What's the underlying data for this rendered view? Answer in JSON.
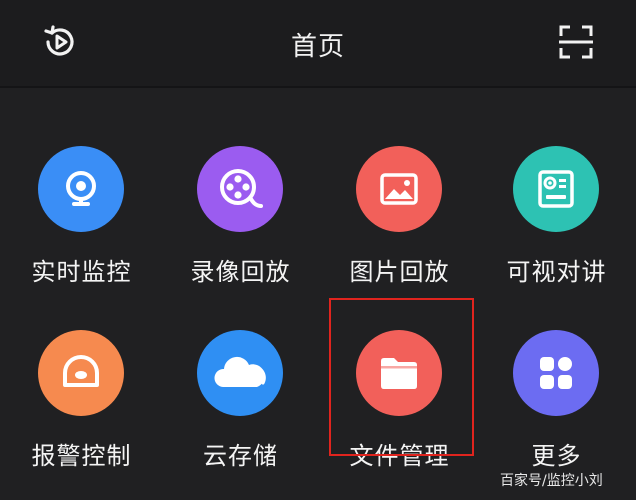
{
  "header": {
    "title": "首页",
    "left_icon": "playback-history-icon",
    "right_icon": "scan-icon"
  },
  "features": [
    {
      "label": "实时监控",
      "icon": "camera-icon",
      "color": "#3a8ef6"
    },
    {
      "label": "录像回放",
      "icon": "film-reel-icon",
      "color": "#9b5cf0"
    },
    {
      "label": "图片回放",
      "icon": "image-icon",
      "color": "#f2605a"
    },
    {
      "label": "可视对讲",
      "icon": "intercom-icon",
      "color": "#2dc2b3"
    },
    {
      "label": "报警控制",
      "icon": "alarm-icon",
      "color": "#f68a4f"
    },
    {
      "label": "云存储",
      "icon": "cloud-icon",
      "color": "#2f8ff3"
    },
    {
      "label": "文件管理",
      "icon": "folder-icon",
      "color": "#f2605a"
    },
    {
      "label": "更多",
      "icon": "more-grid-icon",
      "color": "#6c6cf2"
    }
  ],
  "selected_feature": "文件管理",
  "watermark": "百家号/监控小刘"
}
